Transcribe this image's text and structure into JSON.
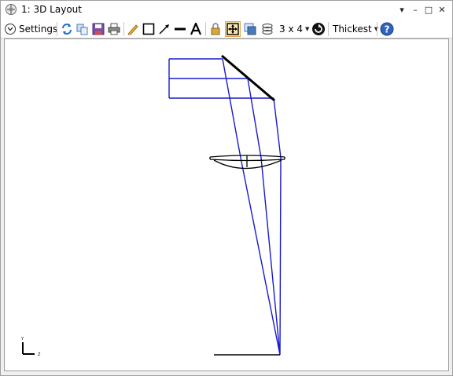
{
  "window": {
    "title": "1: 3D Layout",
    "controls": {
      "dropdown": "▾",
      "minimize": "–",
      "maximize": "□",
      "close": "✕"
    }
  },
  "toolbar": {
    "settings_label": "Settings",
    "icons": [
      "refresh-icon",
      "copy-icon",
      "save-icon",
      "print-icon",
      "pencil-icon",
      "rectangle-icon",
      "arrow-icon",
      "line-icon",
      "text-icon",
      "lock-icon",
      "fit-view-icon",
      "window-icon",
      "layers-icon"
    ],
    "layout_label": "3 x 4",
    "rotate_icon": "rotate-icon",
    "thickness_label": "Thickest",
    "help_icon": "help-icon",
    "active_tool": "fit-view-icon"
  },
  "layout": {
    "axis_label_y": "Y",
    "axis_label_z": "Z",
    "ray_color": "#1a1acc",
    "surface_color": "#000000"
  }
}
